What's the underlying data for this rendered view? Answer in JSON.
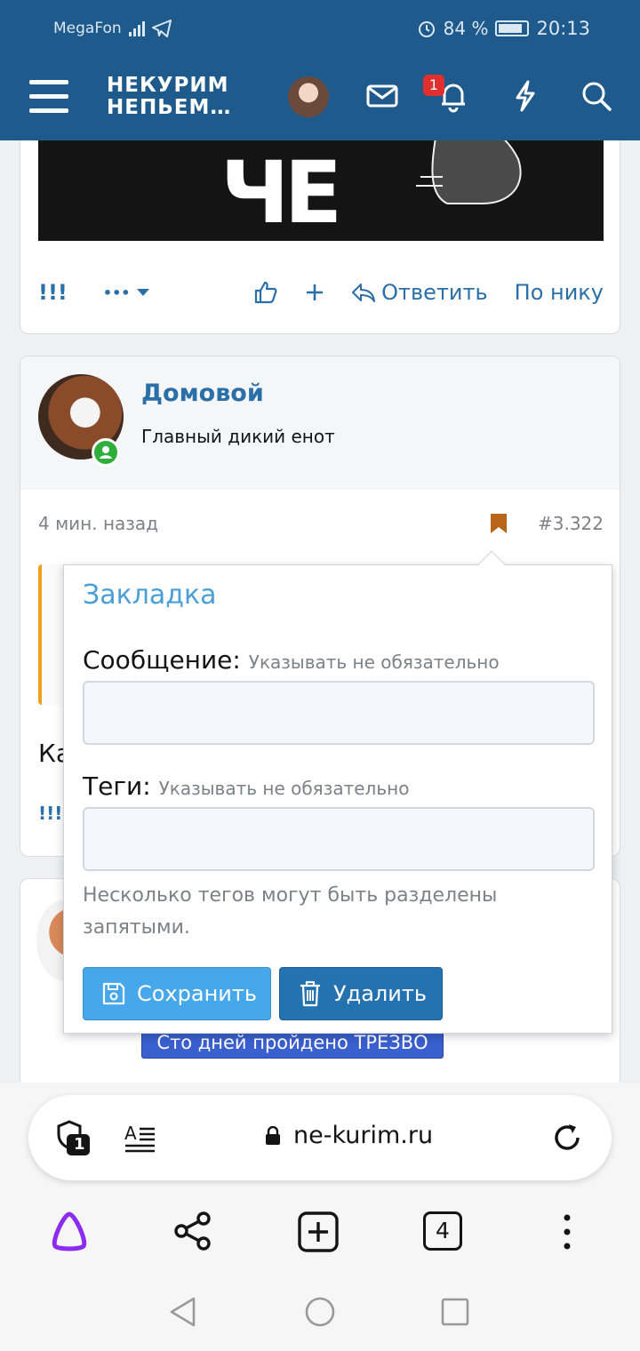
{
  "status_bar": {
    "carrier": "MegaFon",
    "battery": "84 %",
    "time": "20:13"
  },
  "header": {
    "logo_line1": "НЕКУРИМ",
    "logo_line2": "НЕПЬЕМ…",
    "notification_count": "1",
    "icons": [
      "menu-icon",
      "mail-icon",
      "bell-icon",
      "lightning-icon",
      "search-icon"
    ]
  },
  "post_prev": {
    "actions": {
      "marks": "!!!",
      "more": "•••",
      "reply": "Ответить",
      "by_nick": "По нику"
    }
  },
  "post": {
    "author": "Домовой",
    "author_title": "Главный дикий енот",
    "time": "4 мин. назад",
    "number": "#3.322",
    "text_start": "Ка",
    "marks": "!!!"
  },
  "next_post": {
    "banner": "Сто дней пройдено ТРЕЗВО"
  },
  "bookmark_popup": {
    "title": "Закладка",
    "message_label": "Сообщение:",
    "message_hint": "Указывать не обязательно",
    "message_value": "",
    "tags_label": "Теги:",
    "tags_hint": "Указывать не обязательно",
    "tags_value": "",
    "help": "Несколько тегов могут быть разделены запятыми.",
    "save_label": "Сохранить",
    "delete_label": "Удалить"
  },
  "browser": {
    "url": "ne-kurim.ru",
    "shield_count": "1",
    "tab_count": "4"
  },
  "colors": {
    "header_bg": "#1e5a8c",
    "link": "#2b6fa8",
    "bookmark": "#b8651a",
    "save_button": "#47a7eb",
    "delete_button": "#2472b0",
    "online": "#2fae3c"
  }
}
